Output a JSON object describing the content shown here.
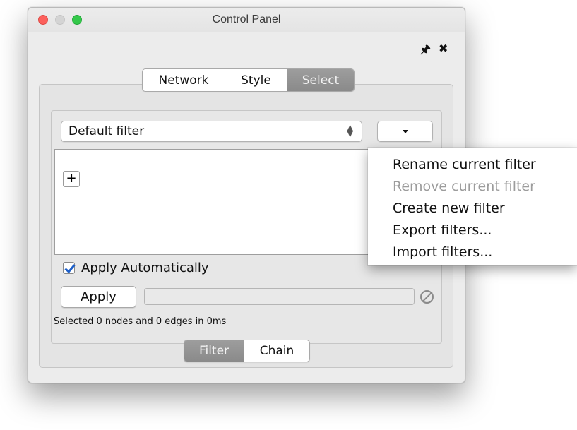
{
  "window": {
    "title": "Control Panel"
  },
  "toolbar_icons": {
    "pin": "pin-icon",
    "close": "close-icon"
  },
  "top_tabs": [
    {
      "label": "Network",
      "active": false
    },
    {
      "label": "Style",
      "active": false
    },
    {
      "label": "Select",
      "active": true
    }
  ],
  "filter": {
    "selected": "Default filter",
    "menu_caret_icon": "chevron-down-icon",
    "add_button_label": "+"
  },
  "apply_automatically": {
    "label": "Apply Automatically",
    "checked": true
  },
  "apply_button": {
    "label": "Apply"
  },
  "status": {
    "text": "Selected 0 nodes and 0 edges in 0ms"
  },
  "bottom_tabs": [
    {
      "label": "Filter",
      "active": true
    },
    {
      "label": "Chain",
      "active": false
    }
  ],
  "menu": {
    "items": [
      {
        "label": "Rename current filter",
        "enabled": true
      },
      {
        "label": "Remove current filter",
        "enabled": false
      },
      {
        "label": "Create new filter",
        "enabled": true
      },
      {
        "label": "Export filters...",
        "enabled": true
      },
      {
        "label": "Import filters...",
        "enabled": true
      }
    ]
  },
  "colors": {
    "window_bg": "#ececec",
    "active_segment": "#8f8f8f",
    "checkbox_check": "#1d5fc9",
    "disabled_text": "#9c9c9c"
  }
}
